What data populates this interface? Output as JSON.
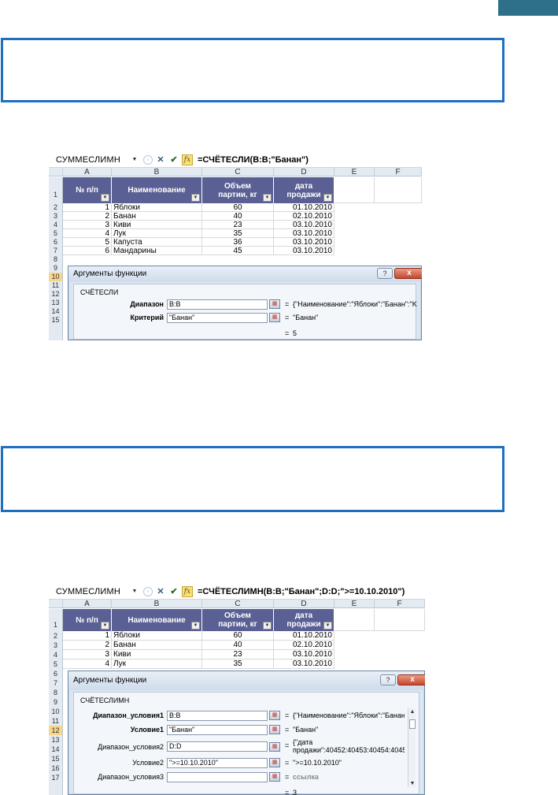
{
  "shot1": {
    "name_box": "СУММЕСЛИМН",
    "formula": "=СЧЁТЕСЛИ(B:B;\"Банан\")",
    "columns": [
      "A",
      "B",
      "C",
      "D",
      "E",
      "F"
    ],
    "headers": {
      "a": "№ п/п",
      "b": "Наименование",
      "c1": "Объем",
      "c2": "партии, кг",
      "d1": "дата",
      "d2": "продажи"
    },
    "row_numbers": [
      "1",
      "2",
      "3",
      "4",
      "5",
      "6",
      "7",
      "8",
      "9",
      "10",
      "11",
      "12",
      "13",
      "14",
      "15"
    ],
    "rows": [
      {
        "n": "1",
        "name": "Яблоки",
        "vol": "60",
        "date": "01.10.2010"
      },
      {
        "n": "2",
        "name": "Банан",
        "vol": "40",
        "date": "02.10.2010"
      },
      {
        "n": "3",
        "name": "Киви",
        "vol": "23",
        "date": "03.10.2010"
      },
      {
        "n": "4",
        "name": "Лук",
        "vol": "35",
        "date": "03.10.2010"
      },
      {
        "n": "5",
        "name": "Капуста",
        "vol": "36",
        "date": "03.10.2010"
      },
      {
        "n": "6",
        "name": "Мандарины",
        "vol": "45",
        "date": "03.10.2010"
      }
    ],
    "dialog": {
      "title": "Аргументы функции",
      "help": "?",
      "close": "x",
      "function_name": "СЧЁТЕСЛИ",
      "args": [
        {
          "label": "Диапазон",
          "value": "B:B",
          "result": "{\"Наименование\":\"Яблоки\":\"Банан\":\"K"
        },
        {
          "label": "Критерий",
          "value": "\"Банан\"",
          "result": "\"Банан\""
        }
      ],
      "total_eq": "=",
      "total": "5"
    }
  },
  "shot2": {
    "name_box": "СУММЕСЛИМН",
    "formula": "=СЧЁТЕСЛИМН(B:B;\"Банан\";D:D;\">=10.10.2010\")",
    "columns": [
      "A",
      "B",
      "C",
      "D",
      "E",
      "F"
    ],
    "headers": {
      "a": "№ п/п",
      "b": "Наименование",
      "c1": "Объем",
      "c2": "партии, кг",
      "d1": "дата",
      "d2": "продажи"
    },
    "row_numbers": [
      "1",
      "2",
      "3",
      "4",
      "5",
      "6",
      "7",
      "8",
      "9",
      "10",
      "11",
      "12",
      "13",
      "14",
      "15",
      "16",
      "17"
    ],
    "rows": [
      {
        "n": "1",
        "name": "Яблоки",
        "vol": "60",
        "date": "01.10.2010"
      },
      {
        "n": "2",
        "name": "Банан",
        "vol": "40",
        "date": "02.10.2010"
      },
      {
        "n": "3",
        "name": "Киви",
        "vol": "23",
        "date": "03.10.2010"
      },
      {
        "n": "4",
        "name": "Лук",
        "vol": "35",
        "date": "03.10.2010"
      }
    ],
    "dialog": {
      "title": "Аргументы функции",
      "help": "?",
      "close": "x",
      "function_name": "СЧЁТЕСЛИМН",
      "args": [
        {
          "label": "Диапазон_условия1",
          "value": "B:B",
          "result": "{\"Наименование\":\"Яблоки\":\"Банан\":"
        },
        {
          "label": "Условие1",
          "value": "\"Банан\"",
          "result": "\"Банан\""
        },
        {
          "label": "Диапазон_условия2",
          "value": "D:D",
          "result1": "{\"дата",
          "result2": "продажи\":40452:40453:40454:4045"
        },
        {
          "label": "Условие2",
          "value": "\">=10.10.2010\"",
          "result": "\">=10.10.2010\""
        },
        {
          "label": "Диапазон_условия3",
          "value": "",
          "result": "ссылка"
        }
      ],
      "total_eq": "=",
      "total": "3"
    }
  }
}
